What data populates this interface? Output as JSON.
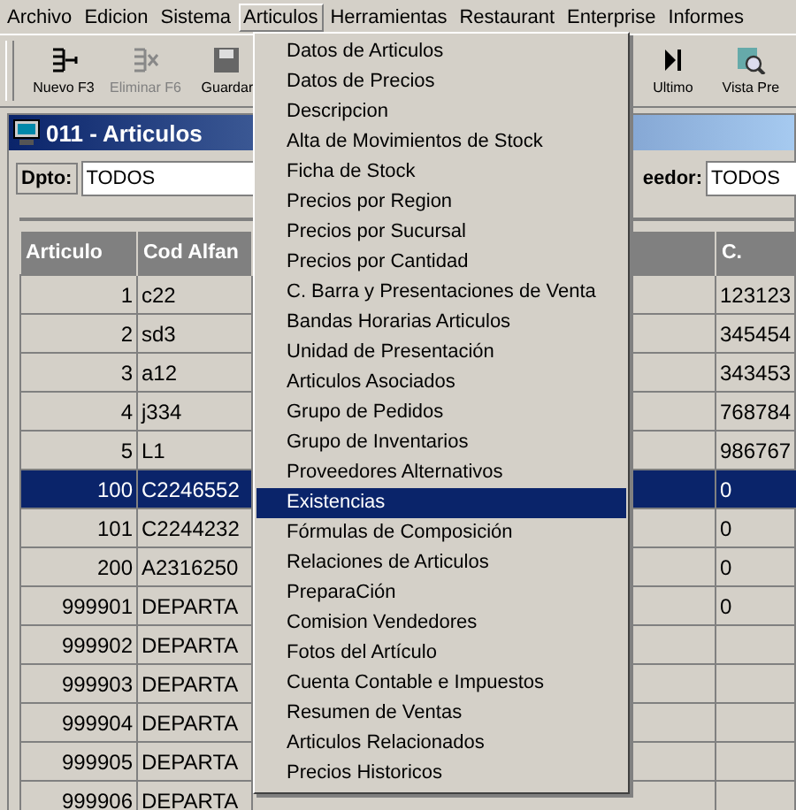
{
  "menubar": [
    {
      "label": "Archivo",
      "selected": false
    },
    {
      "label": "Edicion",
      "selected": false
    },
    {
      "label": "Sistema",
      "selected": false
    },
    {
      "label": "Articulos",
      "selected": true
    },
    {
      "label": "Herramientas",
      "selected": false
    },
    {
      "label": "Restaurant",
      "selected": false
    },
    {
      "label": "Enterprise",
      "selected": false
    },
    {
      "label": "Informes",
      "selected": false
    }
  ],
  "toolbar": [
    {
      "label": "Nuevo F3",
      "kind": "new",
      "disabled": false
    },
    {
      "label": "Eliminar F6",
      "kind": "delete",
      "disabled": true
    },
    {
      "label": "Guardar",
      "kind": "save",
      "disabled": false
    },
    {
      "label": "Ultimo",
      "kind": "last",
      "disabled": false
    },
    {
      "label": "Vista Pre",
      "kind": "preview",
      "disabled": false
    }
  ],
  "window": {
    "title": "011 - Articulos"
  },
  "filters": [
    {
      "label": "Dpto:",
      "value": "TODOS"
    },
    {
      "label": "eedor:",
      "value": "TODOS"
    }
  ],
  "table": {
    "columns": [
      "Articulo",
      "Cod Alfan",
      "",
      "C."
    ],
    "rows": [
      {
        "cells": [
          "1",
          "c22",
          "123123"
        ],
        "selected": false
      },
      {
        "cells": [
          "2",
          "sd3",
          "345454"
        ],
        "selected": false
      },
      {
        "cells": [
          "3",
          "a12",
          "343453"
        ],
        "selected": false
      },
      {
        "cells": [
          "4",
          "j334",
          "768784"
        ],
        "selected": false
      },
      {
        "cells": [
          "5",
          "L1",
          "986767"
        ],
        "selected": false
      },
      {
        "cells": [
          "100",
          "C2246552",
          "0"
        ],
        "selected": true
      },
      {
        "cells": [
          "101",
          "C2244232",
          "0"
        ],
        "selected": false
      },
      {
        "cells": [
          "200",
          "A2316250",
          "0"
        ],
        "selected": false
      },
      {
        "cells": [
          "999901",
          "DEPARTA",
          "0"
        ],
        "selected": false
      },
      {
        "cells": [
          "999902",
          "DEPARTA",
          ""
        ],
        "selected": false
      },
      {
        "cells": [
          "999903",
          "DEPARTA",
          ""
        ],
        "selected": false
      },
      {
        "cells": [
          "999904",
          "DEPARTA",
          ""
        ],
        "selected": false
      },
      {
        "cells": [
          "999905",
          "DEPARTA",
          ""
        ],
        "selected": false
      },
      {
        "cells": [
          "999906",
          "DEPARTA",
          ""
        ],
        "selected": false
      }
    ]
  },
  "menu": {
    "items": [
      {
        "label": "Datos de Articulos",
        "selected": false
      },
      {
        "label": "Datos de Precios",
        "selected": false
      },
      {
        "label": "Descripcion",
        "selected": false
      },
      {
        "label": "Alta de Movimientos de Stock",
        "selected": false
      },
      {
        "label": "Ficha de Stock",
        "selected": false
      },
      {
        "label": "Precios por Region",
        "selected": false
      },
      {
        "label": "Precios por Sucursal",
        "selected": false
      },
      {
        "label": "Precios por Cantidad",
        "selected": false
      },
      {
        "label": "C. Barra y Presentaciones de Venta",
        "selected": false
      },
      {
        "label": "Bandas Horarias Articulos",
        "selected": false
      },
      {
        "label": "Unidad de Presentación",
        "selected": false
      },
      {
        "label": "Articulos Asociados",
        "selected": false
      },
      {
        "label": "Grupo de Pedidos",
        "selected": false
      },
      {
        "label": "Grupo de Inventarios",
        "selected": false
      },
      {
        "label": "Proveedores Alternativos",
        "selected": false
      },
      {
        "label": "Existencias",
        "selected": true
      },
      {
        "label": "Fórmulas de Composición",
        "selected": false
      },
      {
        "label": "Relaciones de Articulos",
        "selected": false
      },
      {
        "label": "PreparaCión",
        "selected": false
      },
      {
        "label": "Comision Vendedores",
        "selected": false
      },
      {
        "label": "Fotos del Artículo",
        "selected": false
      },
      {
        "label": "Cuenta Contable e Impuestos",
        "selected": false
      },
      {
        "label": "Resumen de Ventas",
        "selected": false
      },
      {
        "label": "Articulos Relacionados",
        "selected": false
      },
      {
        "label": "Precios Historicos",
        "selected": false
      }
    ]
  }
}
